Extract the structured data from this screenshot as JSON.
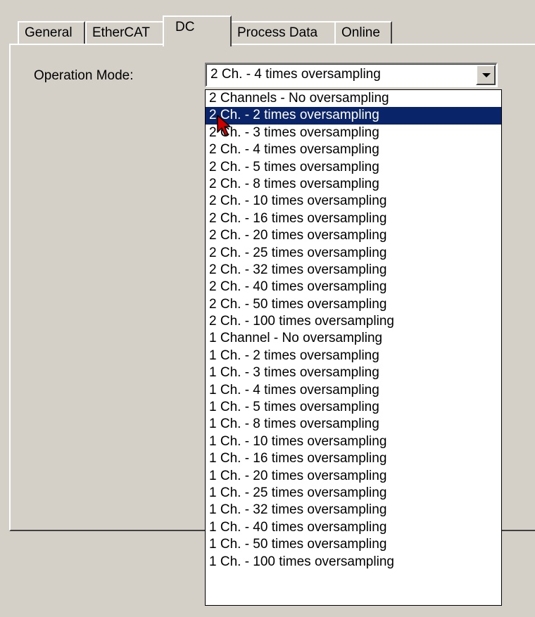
{
  "tabs": [
    {
      "label": "General"
    },
    {
      "label": "EtherCAT"
    },
    {
      "label": "DC"
    },
    {
      "label": "Process Data"
    },
    {
      "label": "Online"
    }
  ],
  "active_tab": "DC",
  "form": {
    "operation_mode_label": "Operation Mode:",
    "operation_mode_value": "2 Ch. - 4 times oversampling"
  },
  "dropdown": {
    "selected_index": 1,
    "options": [
      "2 Channels - No oversampling",
      "2 Ch. - 2 times oversampling",
      "2 Ch. - 3 times oversampling",
      "2 Ch. - 4 times oversampling",
      "2 Ch. - 5 times oversampling",
      "2 Ch. - 8 times oversampling",
      "2 Ch. - 10 times oversampling",
      "2 Ch. - 16 times oversampling",
      "2 Ch. - 20 times oversampling",
      "2 Ch. - 25 times oversampling",
      "2 Ch. - 32 times oversampling",
      "2 Ch. - 40 times oversampling",
      "2 Ch. - 50 times oversampling",
      "2 Ch. - 100 times oversampling",
      "1 Channel - No oversampling",
      "1 Ch. - 2 times oversampling",
      "1 Ch. - 3 times oversampling",
      "1 Ch. - 4 times oversampling",
      "1 Ch. - 5 times oversampling",
      "1 Ch. - 8 times oversampling",
      "1 Ch. - 10 times oversampling",
      "1 Ch. - 16 times oversampling",
      "1 Ch. - 20 times oversampling",
      "1 Ch. - 25 times oversampling",
      "1 Ch. - 32 times oversampling",
      "1 Ch. - 40 times oversampling",
      "1 Ch. - 50 times oversampling",
      "1 Ch. - 100 times oversampling"
    ]
  },
  "colors": {
    "face": "#d4d0c8",
    "selection": "#0a246a",
    "cursor": "#cc0000"
  },
  "icons": {
    "combo_arrow": "chevron-down-icon",
    "pointer": "mouse-cursor-icon"
  }
}
